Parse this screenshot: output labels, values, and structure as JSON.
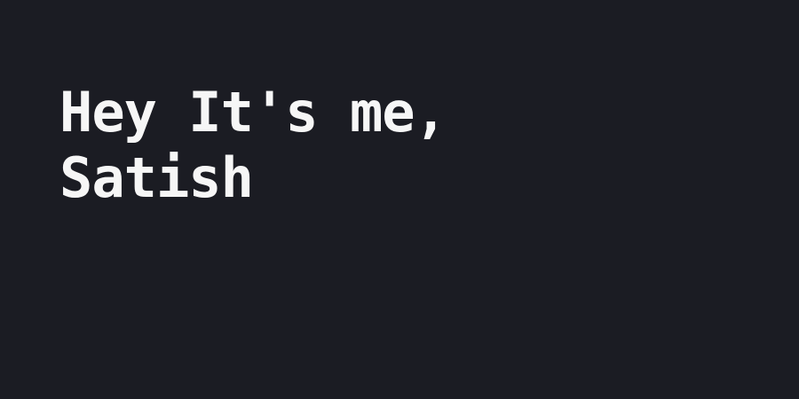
{
  "hero": {
    "line1": "Hey It's me,",
    "line2": "Satish"
  },
  "colors": {
    "background": "#1b1c23",
    "text": "#f6f6f6"
  }
}
